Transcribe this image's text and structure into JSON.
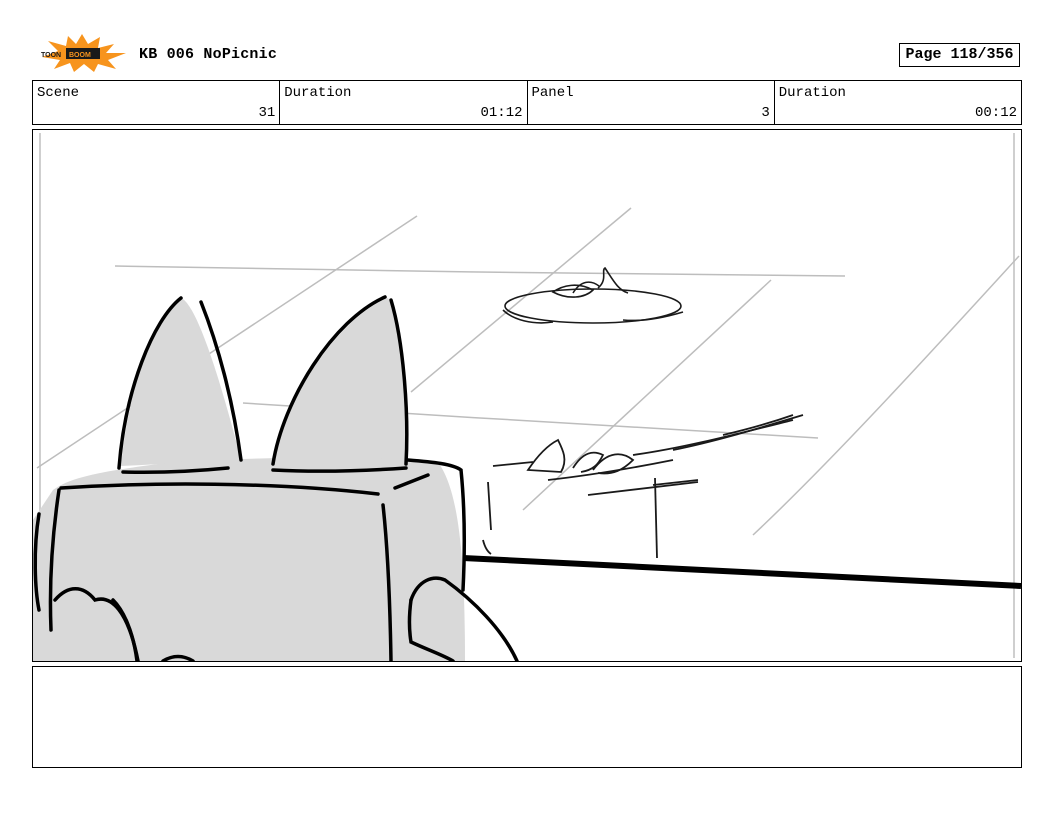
{
  "header": {
    "logo_text": "TOONBOOM",
    "title": "KB 006 NoPicnic",
    "page_label": "Page 118/356"
  },
  "info": {
    "scene_label": "Scene",
    "scene_value": "31",
    "scene_duration_label": "Duration",
    "scene_duration_value": "01:12",
    "panel_label": "Panel",
    "panel_value": "3",
    "panel_duration_label": "Duration",
    "panel_duration_value": "00:12"
  },
  "colors": {
    "logo_burst": "#f7941d",
    "logo_box": "#1a1a1a",
    "sketch_fill": "#d9d9d9",
    "guide_line": "#bdbdbd"
  }
}
